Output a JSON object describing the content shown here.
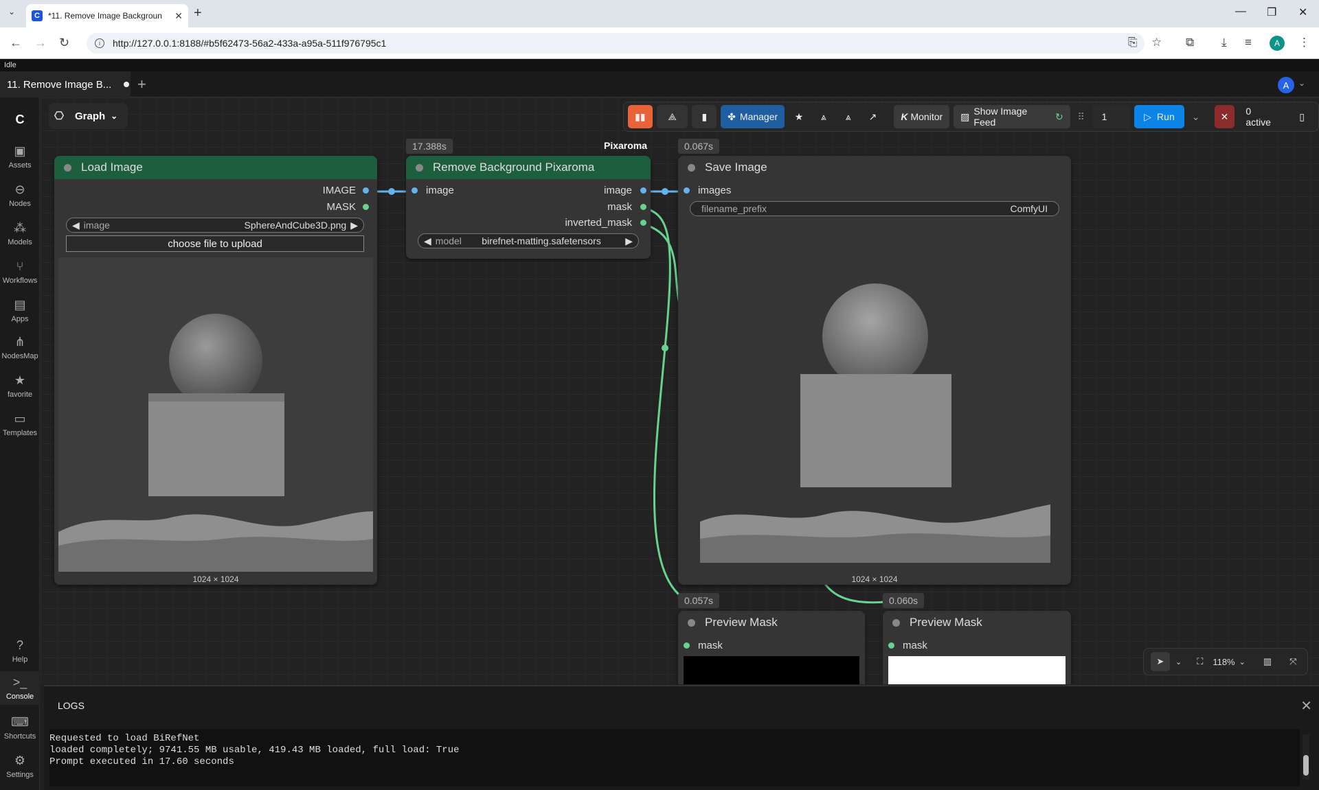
{
  "browser": {
    "tab_title": "*11. Remove Image Backgroun",
    "url": "http://127.0.0.1:8188/#b5f62473-56a2-433a-a95a-511f976795c1",
    "profile_initial": "A"
  },
  "status": "Idle",
  "workflow_tab": {
    "label": "11. Remove Image B..."
  },
  "user_initial": "A",
  "sidebar": {
    "items": [
      {
        "label": "Assets",
        "icon": "image-icon"
      },
      {
        "label": "Nodes",
        "icon": "nodes-icon"
      },
      {
        "label": "Models",
        "icon": "models-icon"
      },
      {
        "label": "Workflows",
        "icon": "workflows-icon"
      },
      {
        "label": "Apps",
        "icon": "apps-icon"
      },
      {
        "label": "NodesMap",
        "icon": "nodesmap-icon"
      },
      {
        "label": "favorite",
        "icon": "star-icon"
      },
      {
        "label": "Templates",
        "icon": "templates-icon"
      }
    ],
    "bottom": [
      {
        "label": "Help",
        "icon": "help-icon"
      },
      {
        "label": "Console",
        "icon": "console-icon"
      },
      {
        "label": "Shortcuts",
        "icon": "keyboard-icon"
      },
      {
        "label": "Settings",
        "icon": "gear-icon"
      }
    ]
  },
  "graph_button": "Graph",
  "toolbar": {
    "manager": "Manager",
    "monitor": "Monitor",
    "image_feed": "Show Image Feed",
    "queue_count": "1",
    "run": "Run",
    "active": "0 active"
  },
  "pixaroma_label": "Pixaroma",
  "nodes": {
    "load_image": {
      "title": "Load Image",
      "out_image": "IMAGE",
      "out_mask": "MASK",
      "widget_label": "image",
      "widget_value": "SphereAndCube3D.png",
      "upload": "choose file to upload",
      "dims": "1024 × 1024"
    },
    "remove_bg": {
      "title": "Remove Background Pixaroma",
      "time": "17.388s",
      "in_image": "image",
      "out_image": "image",
      "out_mask": "mask",
      "out_inverted": "inverted_mask",
      "widget_label": "model",
      "widget_value": "birefnet-matting.safetensors"
    },
    "save_image": {
      "title": "Save Image",
      "time": "0.067s",
      "in_images": "images",
      "widget_label": "filename_prefix",
      "widget_value": "ComfyUI",
      "dims": "1024 × 1024"
    },
    "preview1": {
      "title": "Preview Mask",
      "time": "0.057s",
      "in_mask": "mask"
    },
    "preview2": {
      "title": "Preview Mask",
      "time": "0.060s",
      "in_mask": "mask"
    }
  },
  "zoom": "118%",
  "logs": {
    "title": "LOGS",
    "lines": [
      "Requested to load BiRefNet",
      "loaded completely; 9741.55 MB usable, 419.43 MB loaded, full load: True",
      "Prompt executed in 17.60 seconds"
    ]
  },
  "colors": {
    "node_header_green": "#1d5e3d",
    "run_blue": "#0b84e8",
    "manager_blue": "#1f5fa0",
    "link_blue": "#63b3ed",
    "link_green": "#68d391",
    "accent_orange": "#e8633a",
    "stop_red": "#8b2b2b"
  }
}
